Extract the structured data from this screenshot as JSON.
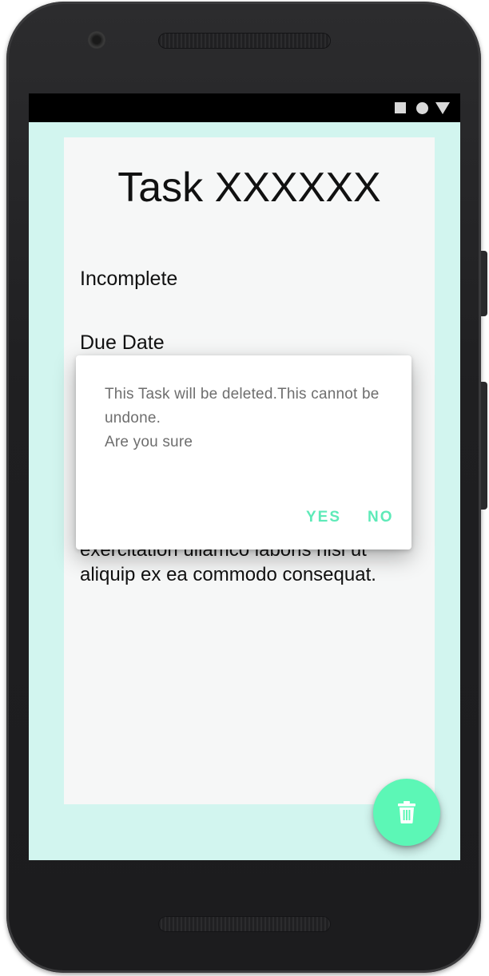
{
  "task": {
    "title": "Task XXXXXX",
    "status": "Incomplete",
    "due_label": "Due Date",
    "description": "enim ad minim veniam, quis nostrud exercitation ullamco laboris nisi ut aliquip ex ea commodo consequat."
  },
  "dialog": {
    "message": "This Task will be deleted.This cannot be undone.\nAre you sure",
    "yes_label": "YES",
    "no_label": "NO",
    "button_color": "#5eeab8"
  },
  "fab": {
    "icon": "trash-icon",
    "color": "#5cf7b6"
  },
  "theme": {
    "screen_background": "#d2f5ef",
    "card_background": "#f6f7f7"
  },
  "status_bar": {
    "icons": [
      "square-icon",
      "circle-icon",
      "triangle-icon"
    ]
  }
}
